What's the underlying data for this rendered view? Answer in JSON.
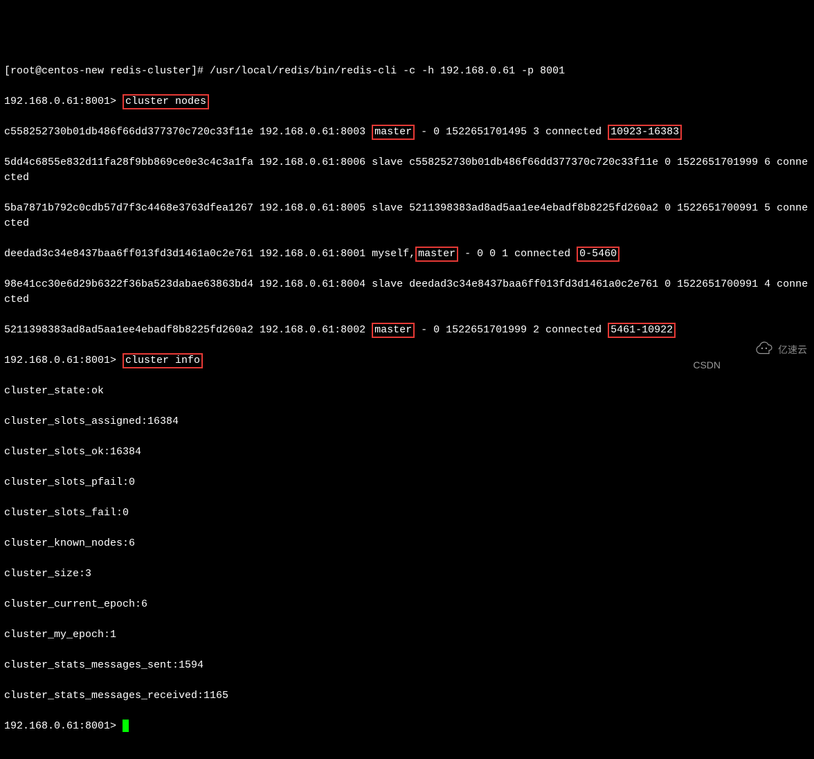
{
  "cmd_line": "[root@centos-new redis-cluster]# /usr/local/redis/bin/redis-cli -c -h 192.168.0.61 -p 8001",
  "prompt1": "192.168.0.61:8001> ",
  "cluster_nodes_cmd": "cluster nodes",
  "node1_a": "c558252730b01db486f66dd377370c720c33f11e 192.168.0.61:8003 ",
  "node1_master": "master",
  "node1_b": " - 0 1522651701495 3 connected ",
  "node1_slots": "10923-16383",
  "node2": "5dd4c6855e832d11fa28f9bb869ce0e3c4c3a1fa 192.168.0.61:8006 slave c558252730b01db486f66dd377370c720c33f11e 0 1522651701999 6 connected",
  "node3": "5ba7871b792c0cdb57d7f3c4468e3763dfea1267 192.168.0.61:8005 slave 5211398383ad8ad5aa1ee4ebadf8b8225fd260a2 0 1522651700991 5 connected",
  "node4_a": "deedad3c34e8437baa6ff013fd3d1461a0c2e761 192.168.0.61:8001 myself,",
  "node4_master": "master",
  "node4_b": " - 0 0 1 connected ",
  "node4_slots": "0-5460",
  "node5": "98e41cc30e6d29b6322f36ba523dabae63863bd4 192.168.0.61:8004 slave deedad3c34e8437baa6ff013fd3d1461a0c2e761 0 1522651700991 4 connected",
  "node6_a": "5211398383ad8ad5aa1ee4ebadf8b8225fd260a2 192.168.0.61:8002 ",
  "node6_master": "master",
  "node6_b": " - 0 1522651701999 2 connected ",
  "node6_slots": "5461-10922",
  "prompt2": "192.168.0.61:8001> ",
  "cluster_info_cmd": "cluster info",
  "info_state": "cluster_state:ok",
  "info_slots_assigned": "cluster_slots_assigned:16384",
  "info_slots_ok": "cluster_slots_ok:16384",
  "info_slots_pfail": "cluster_slots_pfail:0",
  "info_slots_fail": "cluster_slots_fail:0",
  "info_known_nodes": "cluster_known_nodes:6",
  "info_size": "cluster_size:3",
  "info_current_epoch": "cluster_current_epoch:6",
  "info_my_epoch": "cluster_my_epoch:1",
  "info_msg_sent": "cluster_stats_messages_sent:1594",
  "info_msg_received": "cluster_stats_messages_received:1165",
  "prompt3": "192.168.0.61:8001> ",
  "csdn_text": "CSDN",
  "watermark_text": "亿速云"
}
